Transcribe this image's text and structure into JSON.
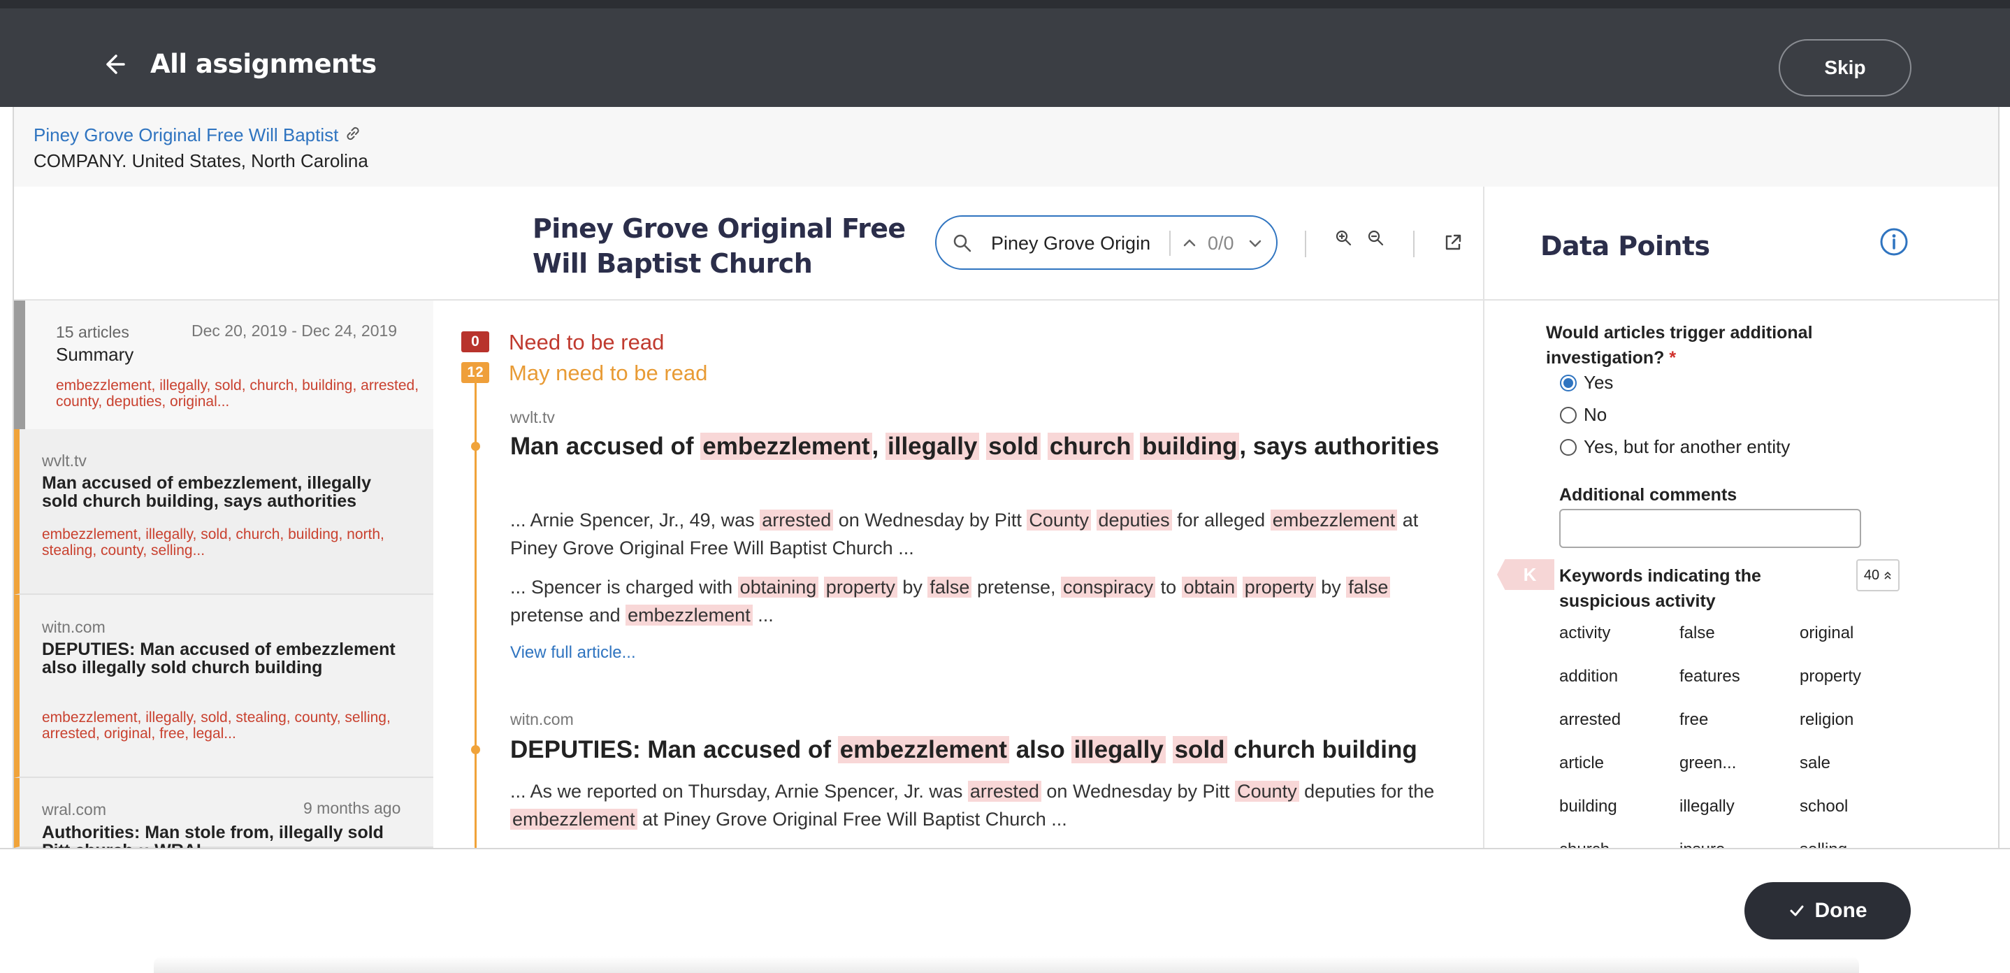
{
  "header": {
    "title": "All assignments",
    "skip_label": "Skip"
  },
  "entity": {
    "name": "Piney Grove Original Free Will Baptist",
    "subtitle": "COMPANY. United States, North Carolina"
  },
  "reader": {
    "doc_title": "Piney Grove Original Free Will Baptist Church",
    "search_value": "Piney Grove Origin",
    "match_count": "0/0"
  },
  "left": {
    "summary": {
      "count": "15 articles",
      "dates": "Dec 20, 2019 - Dec 24, 2019",
      "title": "Summary",
      "keywords": "embezzlement, illegally, sold, church, building, arrested, county, deputies, original..."
    },
    "articles": [
      {
        "source": "wvlt.tv",
        "time": "",
        "title": "Man accused of embezzlement, illegally sold church building, says authorities",
        "keywords": "embezzlement, illegally, sold, church, building, north, stealing, county, selling..."
      },
      {
        "source": "witn.com",
        "time": "",
        "title": "DEPUTIES: Man accused of embezzlement also illegally sold church building",
        "keywords": "embezzlement, illegally, sold, stealing, county, selling, arrested, original, free, legal..."
      },
      {
        "source": "wral.com",
        "time": "9 months ago",
        "title": "Authorities: Man stole from, illegally sold Pitt church :: WRAL",
        "keywords": ""
      }
    ]
  },
  "sections": {
    "need_count": "0",
    "need_label": "Need to be read",
    "may_count": "12",
    "may_label": "May need to be read"
  },
  "articles_main": {
    "a1": {
      "source": "wvlt.tv",
      "t": [
        "Man accused of ",
        "embezzlement",
        ", ",
        "illegally",
        " ",
        "sold",
        " ",
        "church",
        " ",
        "building",
        ", says authorities"
      ],
      "s1": [
        "... Arnie Spencer, Jr., 49, was ",
        "arrested",
        " on Wednesday by Pitt ",
        "County",
        " ",
        "deputies",
        " for alleged ",
        "embezzlement",
        " at Piney Grove Original Free Will Baptist Church ..."
      ],
      "s2": [
        "... Spencer is charged with ",
        "obtaining",
        " ",
        "property",
        " by ",
        "false",
        " pretense, ",
        "conspiracy",
        " to ",
        "obtain",
        " ",
        "property",
        " by ",
        "false",
        " pretense and ",
        "embezzlement",
        " ..."
      ],
      "link": "View full article..."
    },
    "a2": {
      "source": "witn.com",
      "t": [
        "DEPUTIES: Man accused of ",
        "embezzlement",
        " also ",
        "illegally",
        " ",
        "sold",
        " church building"
      ],
      "s1": [
        "... As we reported on Thursday, Arnie Spencer, Jr. was ",
        "arrested",
        " on Wednesday by Pitt ",
        "County",
        " deputies for the ",
        "embezzlement",
        " at Piney Grove Original Free Will Baptist Church ..."
      ]
    }
  },
  "data_points": {
    "title": "Data Points",
    "question": "Would articles trigger additional investigation?",
    "required_mark": "*",
    "options": [
      "Yes",
      "No",
      "Yes, but for another entity"
    ],
    "selected": "Yes",
    "comments_label": "Additional comments",
    "comments_value": "",
    "k_badge": "K",
    "keywords_label": "Keywords indicating the suspicious activity",
    "keywords_count": "40",
    "keywords": [
      "activity",
      "false",
      "original",
      "addition",
      "features",
      "property",
      "arrested",
      "free",
      "religion",
      "article",
      "green...",
      "sale",
      "building",
      "illegally",
      "school",
      "church",
      "insure",
      "selling"
    ]
  },
  "footer": {
    "done_label": "Done"
  },
  "colors": {
    "accent": "#2f74c0",
    "header_bg": "#3b3e44",
    "highlight": "#f8d7d7",
    "need_red": "#b8332c",
    "may_orange": "#ef9f3a"
  }
}
